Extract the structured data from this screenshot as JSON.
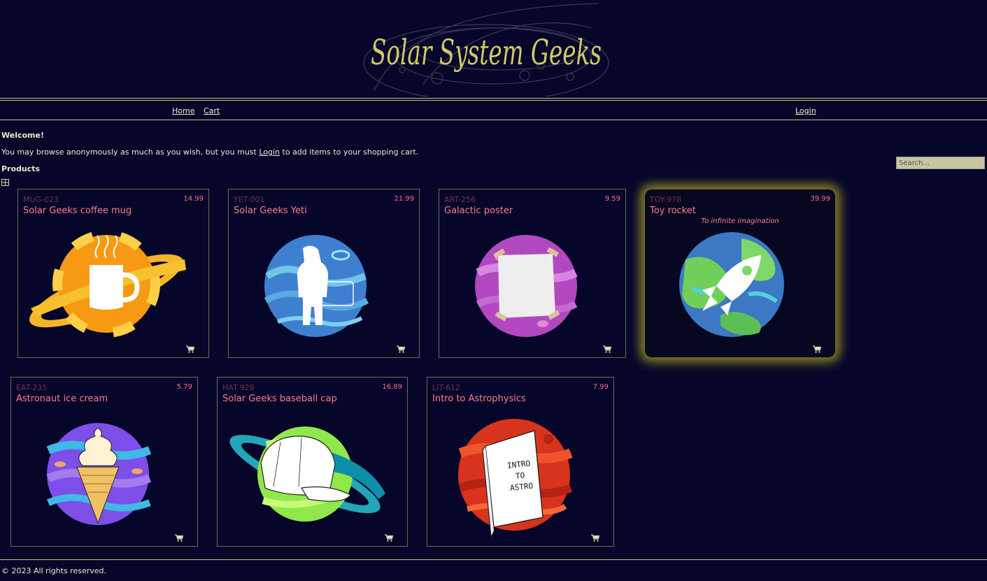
{
  "header": {
    "logo_text": "Solar System Geeks"
  },
  "nav": {
    "home_label": "Home",
    "cart_label": "Cart",
    "login_label": "Login"
  },
  "welcome": {
    "title": "Welcome!",
    "text_before": "You may browse anonymously as much as you wish, but you must ",
    "login_link": "Login",
    "text_after": " to add items to your shopping cart."
  },
  "products_heading": "Products",
  "search": {
    "placeholder": "Search..."
  },
  "products": [
    {
      "sku": "MUG-023",
      "name": "Solar Geeks coffee mug",
      "price": "14.99",
      "tagline": ""
    },
    {
      "sku": "YET-001",
      "name": "Solar Geeks Yeti",
      "price": "21.99",
      "tagline": ""
    },
    {
      "sku": "ART-256",
      "name": "Galactic poster",
      "price": "9.59",
      "tagline": ""
    },
    {
      "sku": "TOY-978",
      "name": "Toy rocket",
      "price": "39.99",
      "tagline": "To infinite imagination"
    },
    {
      "sku": "EAT-235",
      "name": "Astronaut ice cream",
      "price": "5.79",
      "tagline": ""
    },
    {
      "sku": "HAT-928",
      "name": "Solar Geeks baseball cap",
      "price": "16.89",
      "tagline": ""
    },
    {
      "sku": "LIT-612",
      "name": "Intro to Astrophysics",
      "price": "7.99",
      "tagline": "",
      "book_text": [
        "INTRO",
        "TO",
        "ASTRO"
      ]
    }
  ],
  "footer": {
    "copyright": "© 2023 All rights reserved."
  },
  "colors": {
    "background": "#05062a",
    "accent": "#c9c47a",
    "product_name": "#ff7b8a",
    "sku": "#7b2f4b",
    "featured_glow": "#e2d724"
  }
}
